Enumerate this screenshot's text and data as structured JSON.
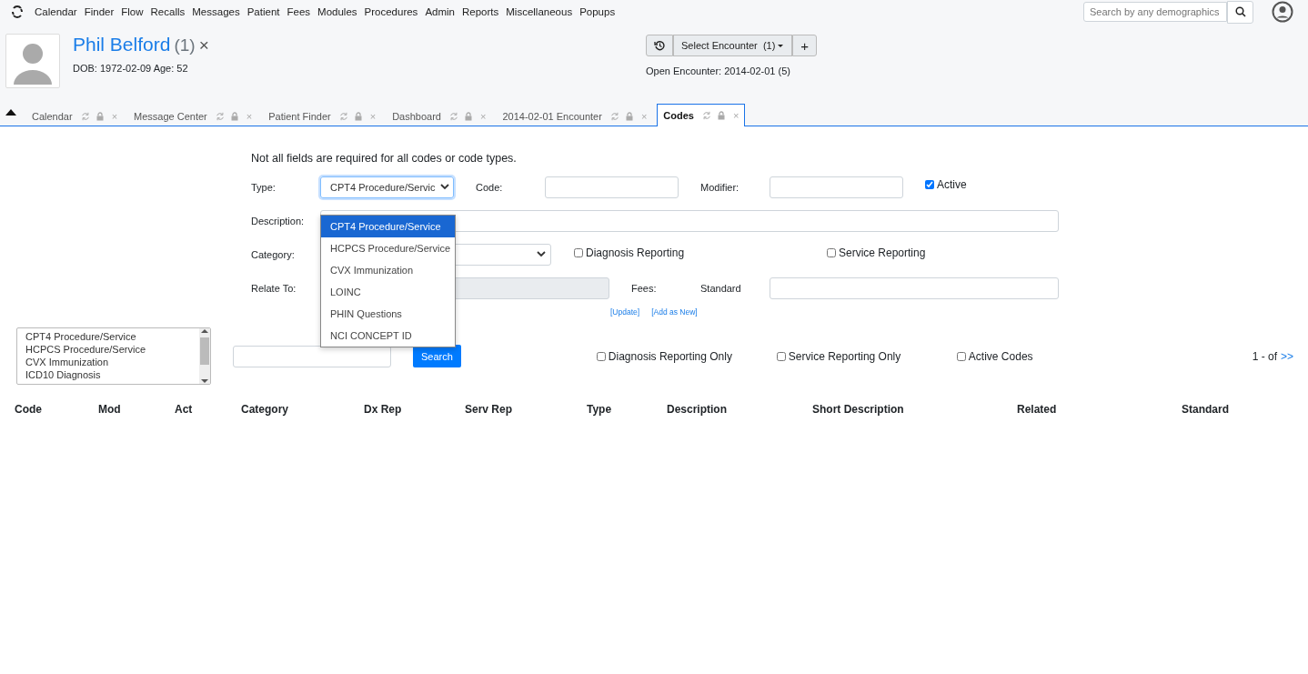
{
  "navbar": {
    "menu": [
      "Calendar",
      "Finder",
      "Flow",
      "Recalls",
      "Messages",
      "Patient",
      "Fees",
      "Modules",
      "Procedures",
      "Admin",
      "Reports",
      "Miscellaneous",
      "Popups"
    ],
    "search": {
      "placeholder": "Search by any demographics"
    }
  },
  "patient": {
    "name": "Phil Belford",
    "count": "(1)",
    "close": "×",
    "details": "DOB: 1972-02-09 Age: 52"
  },
  "encounter": {
    "select_label": "Select Encounter",
    "select_count": "(1)",
    "add": "+",
    "open_encounter": "Open Encounter: 2014-02-01 (5)"
  },
  "tabs": [
    {
      "label": "Calendar",
      "selected": false,
      "close": "×"
    },
    {
      "label": "Message Center",
      "selected": false,
      "close": "×"
    },
    {
      "label": "Patient Finder",
      "selected": false,
      "close": "×"
    },
    {
      "label": "Dashboard",
      "selected": false,
      "close": "×"
    },
    {
      "label": "2014-02-01 Encounter",
      "selected": false,
      "close": "×"
    },
    {
      "label": "Codes",
      "selected": true,
      "close": "×"
    }
  ],
  "form": {
    "note": "Not all fields are required for all codes or code types.",
    "type_label": "Type:",
    "type_value": "CPT4 Procedure/Servic",
    "type_options": [
      {
        "label": "CPT4 Procedure/Service",
        "selected": true
      },
      {
        "label": "HCPCS Procedure/Service",
        "selected": false
      },
      {
        "label": "CVX Immunization",
        "selected": false
      },
      {
        "label": "LOINC",
        "selected": false
      },
      {
        "label": "PHIN Questions",
        "selected": false
      },
      {
        "label": "NCI CONCEPT ID",
        "selected": false
      }
    ],
    "code_label": "Code:",
    "modifier_label": "Modifier:",
    "active": {
      "label": "Active",
      "checked": true
    },
    "description_label": "Description:",
    "category_label": "Category:",
    "diagnosis_reporting": {
      "label": "Diagnosis Reporting",
      "checked": false
    },
    "service_reporting": {
      "label": "Service Reporting",
      "checked": false
    },
    "relate_label": "Relate To:",
    "fees_label": "Fees:",
    "standard_label": "Standard",
    "links": [
      "[Update]",
      "[Add as New]"
    ]
  },
  "filter": {
    "code_types": [
      "CPT4 Procedure/Service",
      "HCPCS Procedure/Service",
      "CVX Immunization",
      "ICD10 Diagnosis"
    ],
    "search_button": "Search",
    "checks": [
      {
        "label": "Diagnosis Reporting Only",
        "checked": false
      },
      {
        "label": "Service Reporting Only",
        "checked": false
      },
      {
        "label": "Active Codes",
        "checked": false
      }
    ],
    "pager": "1 - of",
    "next": ">>"
  },
  "table": {
    "columns": [
      "Code",
      "Mod",
      "Act",
      "Category",
      "Dx Rep",
      "Serv Rep",
      "Type",
      "Description",
      "Short Description",
      "Related",
      "Standard"
    ]
  }
}
